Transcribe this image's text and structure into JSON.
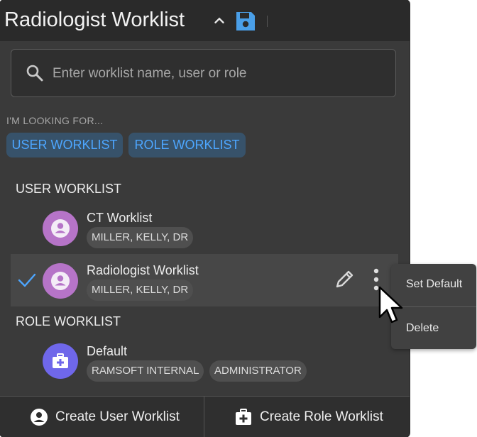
{
  "header": {
    "title": "Radiologist Worklist",
    "chevron_icon": "chevron-up-icon",
    "save_icon": "floppy-disk-icon"
  },
  "search": {
    "placeholder": "Enter worklist name, user or role",
    "value": ""
  },
  "filters": {
    "label": "I'M LOOKING FOR...",
    "chips": [
      "USER WORKLIST",
      "ROLE WORKLIST"
    ],
    "chip_color": "#4da6ff",
    "chip_bg": "#37526a"
  },
  "user_section": {
    "heading": "USER WORKLIST",
    "items": [
      {
        "name": "CT Worklist",
        "tags": [
          "MILLER, KELLY, DR"
        ],
        "icon": "user-avatar-icon",
        "selected": false
      },
      {
        "name": "Radiologist Worklist",
        "tags": [
          "MILLER, KELLY, DR"
        ],
        "icon": "user-avatar-icon",
        "selected": true
      }
    ]
  },
  "role_section": {
    "heading": "ROLE WORKLIST",
    "items": [
      {
        "name": "Default",
        "tags": [
          "RAMSOFT INTERNAL",
          "ADMINISTRATOR"
        ],
        "icon": "medical-case-icon"
      }
    ]
  },
  "footer": {
    "create_user": "Create User Worklist",
    "create_role": "Create Role Worklist"
  },
  "context_menu": {
    "set_default": "Set Default",
    "delete": "Delete"
  },
  "colors": {
    "panel_bg": "#3a3a3a",
    "accent_blue": "#4da6ff",
    "user_avatar": "#b674c8",
    "role_avatar": "#6f67ea"
  }
}
